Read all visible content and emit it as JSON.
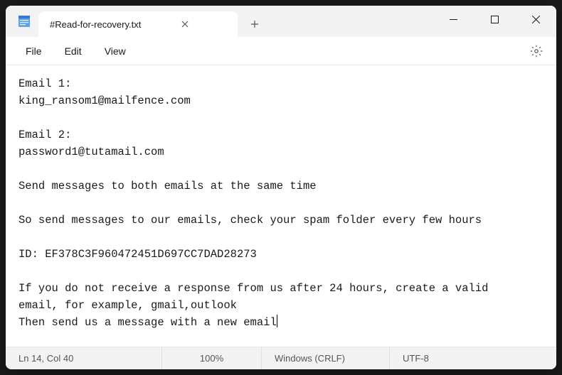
{
  "titlebar": {
    "tab_title": "#Read-for-recovery.txt"
  },
  "menu": {
    "file": "File",
    "edit": "Edit",
    "view": "View"
  },
  "editor": {
    "content": "Email 1:\nking_ransom1@mailfence.com\n\nEmail 2:\npassword1@tutamail.com\n\nSend messages to both emails at the same time\n\nSo send messages to our emails, check your spam folder every few hours\n\nID: EF378C3F960472451D697CC7DAD28273\n\nIf you do not receive a response from us after 24 hours, create a valid\nemail, for example, gmail,outlook\nThen send us a message with a new email"
  },
  "status": {
    "position": "Ln 14, Col 40",
    "zoom": "100%",
    "line_ending": "Windows (CRLF)",
    "encoding": "UTF-8"
  }
}
